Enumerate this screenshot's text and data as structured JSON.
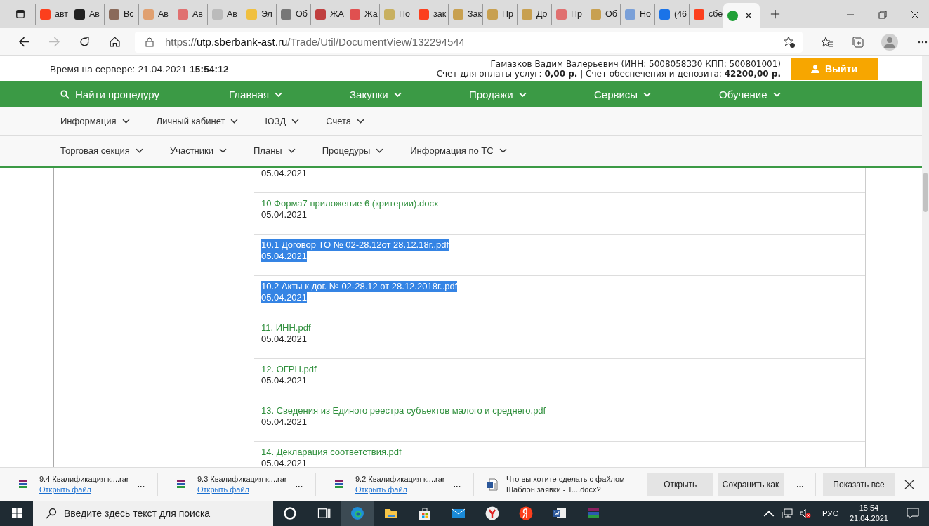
{
  "browser": {
    "tabs": [
      {
        "label": "авт",
        "selected": false,
        "color": "#fc3f1d"
      },
      {
        "label": "Ав",
        "selected": false,
        "color": "#222222"
      },
      {
        "label": "Вс",
        "selected": false,
        "color": "#8a6a5a"
      },
      {
        "label": "Ав",
        "selected": false,
        "color": "#e0a070"
      },
      {
        "label": "Ав",
        "selected": false,
        "color": "#e07070"
      },
      {
        "label": "Ав",
        "selected": false,
        "color": "#bbbbbb"
      },
      {
        "label": "Эл",
        "selected": false,
        "color": "#f0c040"
      },
      {
        "label": "Об",
        "selected": false,
        "color": "#777777"
      },
      {
        "label": "ЖА",
        "selected": false,
        "color": "#c04040"
      },
      {
        "label": "Жа",
        "selected": false,
        "color": "#e05050"
      },
      {
        "label": "По",
        "selected": false,
        "color": "#c8b060"
      },
      {
        "label": "зак",
        "selected": false,
        "color": "#fc3f1d"
      },
      {
        "label": "Зак",
        "selected": false,
        "color": "#c8a050"
      },
      {
        "label": "Пр",
        "selected": false,
        "color": "#c8a050"
      },
      {
        "label": "До",
        "selected": false,
        "color": "#c8a050"
      },
      {
        "label": "Пр",
        "selected": false,
        "color": "#e07070"
      },
      {
        "label": "Об",
        "selected": false,
        "color": "#c8a050"
      },
      {
        "label": "Но",
        "selected": false,
        "color": "#7aa0d8"
      },
      {
        "label": "(46",
        "selected": false,
        "color": "#1a73e8"
      },
      {
        "label": "сбе",
        "selected": false,
        "color": "#fc3f1d"
      },
      {
        "selected": true,
        "color": "#21a038"
      }
    ],
    "url": {
      "scheme": "https://",
      "host": "utp.sberbank-ast.ru",
      "path": "/Trade/Util/DocumentView/132294544"
    }
  },
  "header": {
    "server_time": "Время на сервере: 21.04.2021 **15:54:12**",
    "user": "Гамазков Вадим Валерьевич (ИНН: 5008058330 КПП: 500801001)",
    "accounts": "Счет для оплаты услуг: **0,00 р.** | Счет обеспечения и депозита: **42200,00 р.**",
    "logout": "Выйти"
  },
  "main_nav": {
    "search": "Найти процедуру",
    "items": [
      "Главная",
      "Закупки",
      "Продажи",
      "Сервисы",
      "Обучение"
    ]
  },
  "sub_nav_1": [
    "Информация",
    "Личный кабинет",
    "ЮЗД",
    "Счета"
  ],
  "sub_nav_2": [
    "Торговая секция",
    "Участники",
    "Планы",
    "Процедуры",
    "Информация по ТС"
  ],
  "documents": [
    {
      "date": "05.04.2021",
      "selected": false
    },
    {
      "name": "10 Форма7 приложение 6 (критерии).docx",
      "date": "05.04.2021",
      "selected": false
    },
    {
      "name": "10.1 Договор ТО № 02-28.12от 28.12.18г..pdf",
      "date": "05.04.2021",
      "selected": true
    },
    {
      "name": "10.2 Акты к дог. № 02-28.12 от 28.12.2018г..pdf",
      "date": "05.04.2021",
      "selected": true
    },
    {
      "name": "11. ИНН.pdf",
      "date": "05.04.2021",
      "selected": false
    },
    {
      "name": "12. ОГРН.pdf",
      "date": "05.04.2021",
      "selected": false
    },
    {
      "name": "13. Сведения из Единого реестра субъектов малого и среднего.pdf",
      "date": "05.04.2021",
      "selected": false
    },
    {
      "name": "14. Декларация соответствия.pdf",
      "date": "05.04.2021",
      "selected": false
    }
  ],
  "downloads": {
    "items": [
      {
        "name": "9.4 Квалификация к....rar",
        "action": "Открыть файл",
        "more": "..."
      },
      {
        "name": "9.3 Квалификация к....rar",
        "action": "Открыть файл",
        "more": "..."
      },
      {
        "name": "9.2 Квалификация к....rar",
        "action": "Открыть файл",
        "more": "..."
      }
    ],
    "prompt": {
      "question": "Что вы хотите сделать с файлом",
      "file": "Шаблон заявки - Т....docx?",
      "open": "Открыть",
      "save_as": "Сохранить как",
      "more": "..."
    },
    "show_all": "Показать все"
  },
  "taskbar": {
    "search_placeholder": "Введите здесь текст для поиска",
    "language": "РУС",
    "time": "15:54",
    "date": "21.04.2021"
  }
}
